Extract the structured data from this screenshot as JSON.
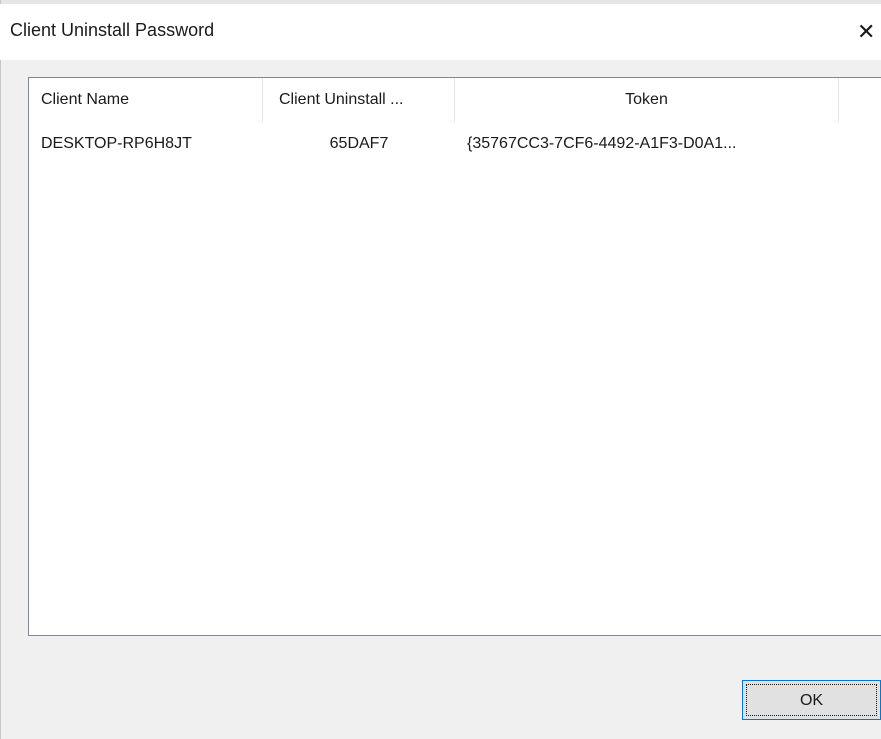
{
  "dialog": {
    "title": "Client Uninstall Password",
    "close_glyph": "✕"
  },
  "table": {
    "columns": [
      "Client Name",
      "Client Uninstall ...",
      "Token",
      ""
    ],
    "rows": [
      {
        "client_name": "DESKTOP-RP6H8JT",
        "uninstall_password": "65DAF7",
        "token": "{35767CC3-7CF6-4492-A1F3-D0A1..."
      }
    ]
  },
  "buttons": {
    "ok_label": "OK"
  },
  "icons": {
    "close": "close-icon"
  }
}
